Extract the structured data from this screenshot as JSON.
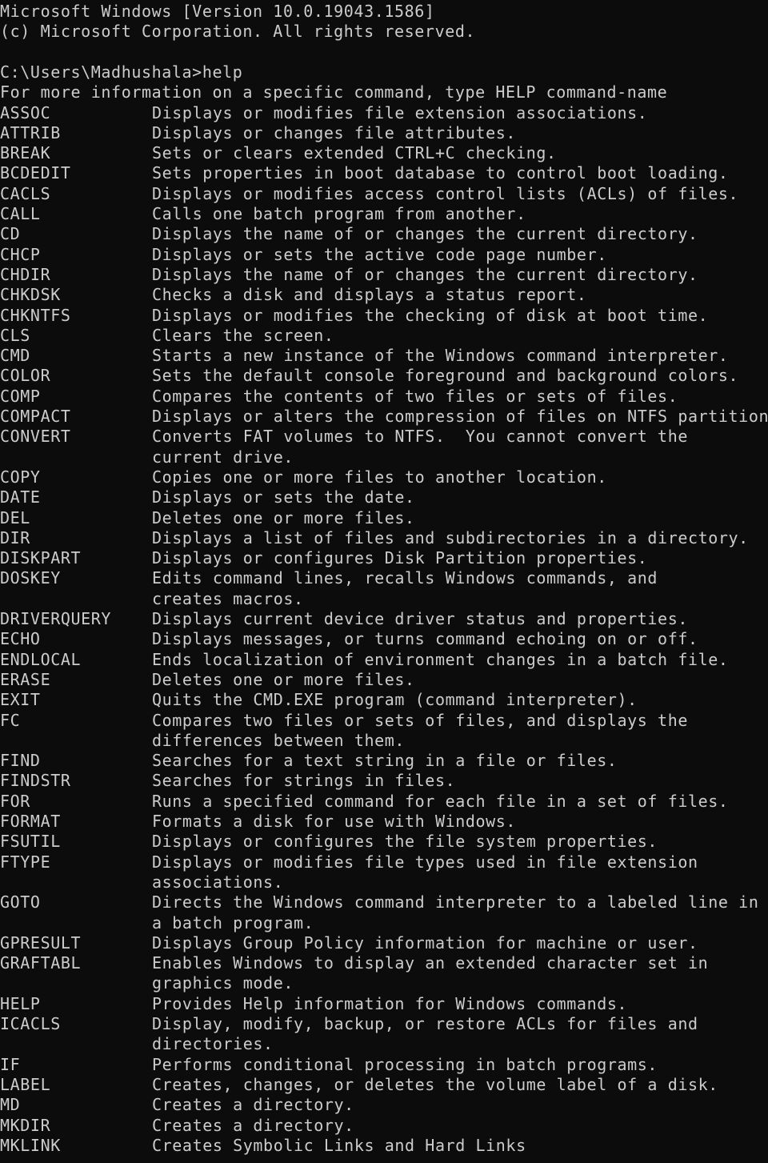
{
  "header": [
    "Microsoft Windows [Version 10.0.19043.1586]",
    "(c) Microsoft Corporation. All rights reserved.",
    "",
    "C:\\Users\\Madhushala>help",
    "For more information on a specific command, type HELP command-name"
  ],
  "commands": [
    {
      "name": "ASSOC",
      "desc": [
        "Displays or modifies file extension associations."
      ]
    },
    {
      "name": "ATTRIB",
      "desc": [
        "Displays or changes file attributes."
      ]
    },
    {
      "name": "BREAK",
      "desc": [
        "Sets or clears extended CTRL+C checking."
      ]
    },
    {
      "name": "BCDEDIT",
      "desc": [
        "Sets properties in boot database to control boot loading."
      ]
    },
    {
      "name": "CACLS",
      "desc": [
        "Displays or modifies access control lists (ACLs) of files."
      ]
    },
    {
      "name": "CALL",
      "desc": [
        "Calls one batch program from another."
      ]
    },
    {
      "name": "CD",
      "desc": [
        "Displays the name of or changes the current directory."
      ]
    },
    {
      "name": "CHCP",
      "desc": [
        "Displays or sets the active code page number."
      ]
    },
    {
      "name": "CHDIR",
      "desc": [
        "Displays the name of or changes the current directory."
      ]
    },
    {
      "name": "CHKDSK",
      "desc": [
        "Checks a disk and displays a status report."
      ]
    },
    {
      "name": "CHKNTFS",
      "desc": [
        "Displays or modifies the checking of disk at boot time."
      ]
    },
    {
      "name": "CLS",
      "desc": [
        "Clears the screen."
      ]
    },
    {
      "name": "CMD",
      "desc": [
        "Starts a new instance of the Windows command interpreter."
      ]
    },
    {
      "name": "COLOR",
      "desc": [
        "Sets the default console foreground and background colors."
      ]
    },
    {
      "name": "COMP",
      "desc": [
        "Compares the contents of two files or sets of files."
      ]
    },
    {
      "name": "COMPACT",
      "desc": [
        "Displays or alters the compression of files on NTFS partition"
      ]
    },
    {
      "name": "CONVERT",
      "desc": [
        "Converts FAT volumes to NTFS.  You cannot convert the",
        "current drive."
      ]
    },
    {
      "name": "COPY",
      "desc": [
        "Copies one or more files to another location."
      ]
    },
    {
      "name": "DATE",
      "desc": [
        "Displays or sets the date."
      ]
    },
    {
      "name": "DEL",
      "desc": [
        "Deletes one or more files."
      ]
    },
    {
      "name": "DIR",
      "desc": [
        "Displays a list of files and subdirectories in a directory."
      ]
    },
    {
      "name": "DISKPART",
      "desc": [
        "Displays or configures Disk Partition properties."
      ]
    },
    {
      "name": "DOSKEY",
      "desc": [
        "Edits command lines, recalls Windows commands, and",
        "creates macros."
      ]
    },
    {
      "name": "DRIVERQUERY",
      "desc": [
        "Displays current device driver status and properties."
      ]
    },
    {
      "name": "ECHO",
      "desc": [
        "Displays messages, or turns command echoing on or off."
      ]
    },
    {
      "name": "ENDLOCAL",
      "desc": [
        "Ends localization of environment changes in a batch file."
      ]
    },
    {
      "name": "ERASE",
      "desc": [
        "Deletes one or more files."
      ]
    },
    {
      "name": "EXIT",
      "desc": [
        "Quits the CMD.EXE program (command interpreter)."
      ]
    },
    {
      "name": "FC",
      "desc": [
        "Compares two files or sets of files, and displays the",
        "differences between them."
      ]
    },
    {
      "name": "FIND",
      "desc": [
        "Searches for a text string in a file or files."
      ]
    },
    {
      "name": "FINDSTR",
      "desc": [
        "Searches for strings in files."
      ]
    },
    {
      "name": "FOR",
      "desc": [
        "Runs a specified command for each file in a set of files."
      ]
    },
    {
      "name": "FORMAT",
      "desc": [
        "Formats a disk for use with Windows."
      ]
    },
    {
      "name": "FSUTIL",
      "desc": [
        "Displays or configures the file system properties."
      ]
    },
    {
      "name": "FTYPE",
      "desc": [
        "Displays or modifies file types used in file extension",
        "associations."
      ]
    },
    {
      "name": "GOTO",
      "desc": [
        "Directs the Windows command interpreter to a labeled line in",
        "a batch program."
      ]
    },
    {
      "name": "GPRESULT",
      "desc": [
        "Displays Group Policy information for machine or user."
      ]
    },
    {
      "name": "GRAFTABL",
      "desc": [
        "Enables Windows to display an extended character set in",
        "graphics mode."
      ]
    },
    {
      "name": "HELP",
      "desc": [
        "Provides Help information for Windows commands."
      ]
    },
    {
      "name": "ICACLS",
      "desc": [
        "Display, modify, backup, or restore ACLs for files and",
        "directories."
      ]
    },
    {
      "name": "IF",
      "desc": [
        "Performs conditional processing in batch programs."
      ]
    },
    {
      "name": "LABEL",
      "desc": [
        "Creates, changes, or deletes the volume label of a disk."
      ]
    },
    {
      "name": "MD",
      "desc": [
        "Creates a directory."
      ]
    },
    {
      "name": "MKDIR",
      "desc": [
        "Creates a directory."
      ]
    },
    {
      "name": "MKLINK",
      "desc": [
        "Creates Symbolic Links and Hard Links"
      ]
    }
  ]
}
